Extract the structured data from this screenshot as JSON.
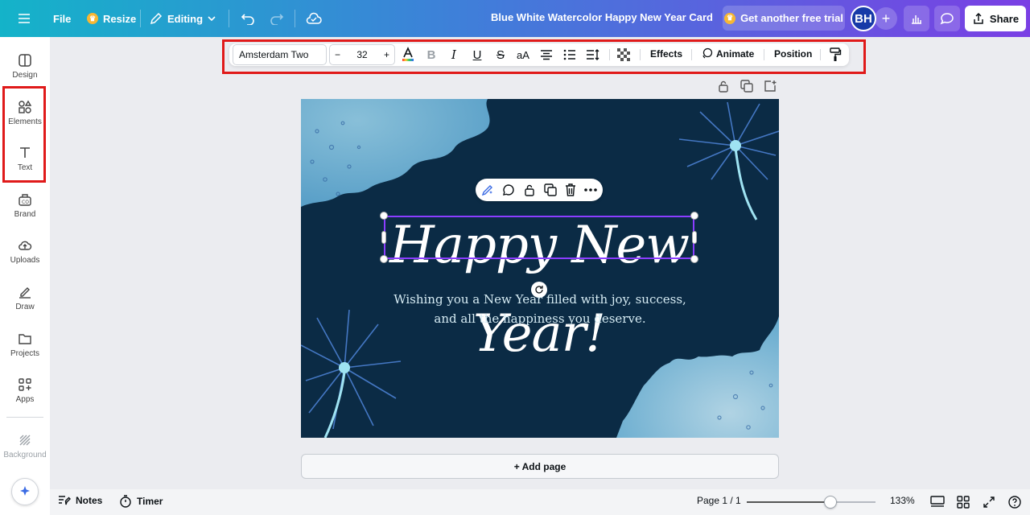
{
  "topbar": {
    "menu_icon": "hamburger-icon",
    "file_label": "File",
    "resize_label": "Resize",
    "editing_label": "Editing",
    "document_title": "Blue White Watercolor Happy New Year  Card",
    "trial_label": "Get another free trial",
    "avatar_initials": "BH",
    "share_label": "Share"
  },
  "sidebar": {
    "items": [
      {
        "label": "Design",
        "icon": "design-icon"
      },
      {
        "label": "Elements",
        "icon": "elements-icon"
      },
      {
        "label": "Text",
        "icon": "text-icon"
      },
      {
        "label": "Brand",
        "icon": "brand-icon"
      },
      {
        "label": "Uploads",
        "icon": "uploads-icon"
      },
      {
        "label": "Draw",
        "icon": "draw-icon"
      },
      {
        "label": "Projects",
        "icon": "projects-icon"
      },
      {
        "label": "Apps",
        "icon": "apps-icon"
      },
      {
        "label": "Background",
        "icon": "background-icon"
      }
    ]
  },
  "toolbar": {
    "font_name": "Amsterdam Two",
    "font_size": "32",
    "decrease": "−",
    "increase": "+",
    "case_label": "aA",
    "effects_label": "Effects",
    "animate_label": "Animate",
    "position_label": "Position"
  },
  "canvas": {
    "headline": "Happy New Year!",
    "subtext_line1": "Wishing you a New Year filled with joy, success,",
    "subtext_line2": "and all the happiness you deserve.",
    "background_color": "#0b2b45"
  },
  "add_page_label": "+ Add page",
  "bottombar": {
    "notes_label": "Notes",
    "timer_label": "Timer",
    "page_indicator": "Page 1 / 1",
    "zoom_label": "133%",
    "zoom_fraction": 0.65
  },
  "colors": {
    "accent": "#8b3dff",
    "highlight_box": "#e01a1a",
    "gradient_start": "#14b3c9",
    "gradient_end": "#7a3fe4"
  }
}
